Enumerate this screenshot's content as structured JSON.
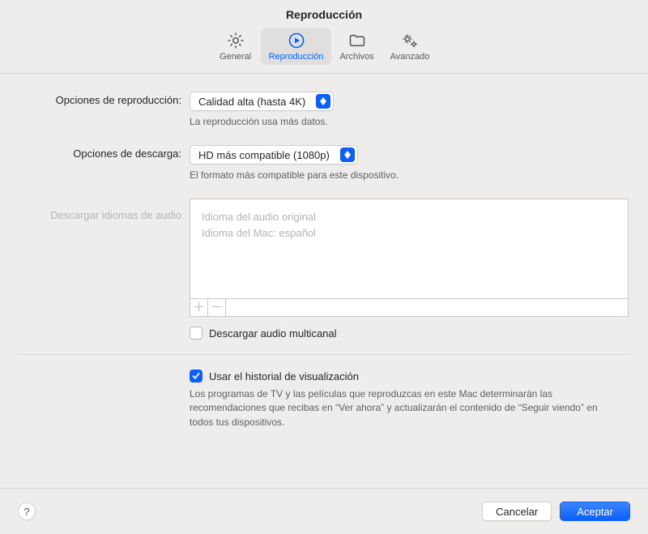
{
  "title": "Reproducción",
  "tabs": {
    "general": "General",
    "playback": "Reproducción",
    "files": "Archivos",
    "advanced": "Avanzado"
  },
  "playbackOptions": {
    "label": "Opciones de reproducción:",
    "value": "Calidad alta (hasta 4K)",
    "hint": "La reproducción usa más datos."
  },
  "downloadOptions": {
    "label": "Opciones de descarga:",
    "value": "HD más compatible (1080p)",
    "hint": "El formato más compatible para este dispositivo."
  },
  "audioLanguages": {
    "label": "Descargar idiomas de audio",
    "items": [
      "Idioma del audio original",
      "Idioma del Mac: español"
    ],
    "addGlyph": "＋",
    "removeGlyph": "－"
  },
  "multichannel": {
    "label": "Descargar audio multicanal",
    "checked": false
  },
  "useHistory": {
    "label": "Usar el historial de visualización",
    "checked": true,
    "description": "Los programas de TV y las películas que reproduzcas en este Mac determinarán las recomendaciones que recibas en “Ver ahora” y actualizarán el contenido de “Seguir viendo” en todos tus dispositivos."
  },
  "buttons": {
    "help": "?",
    "cancel": "Cancelar",
    "accept": "Aceptar"
  }
}
